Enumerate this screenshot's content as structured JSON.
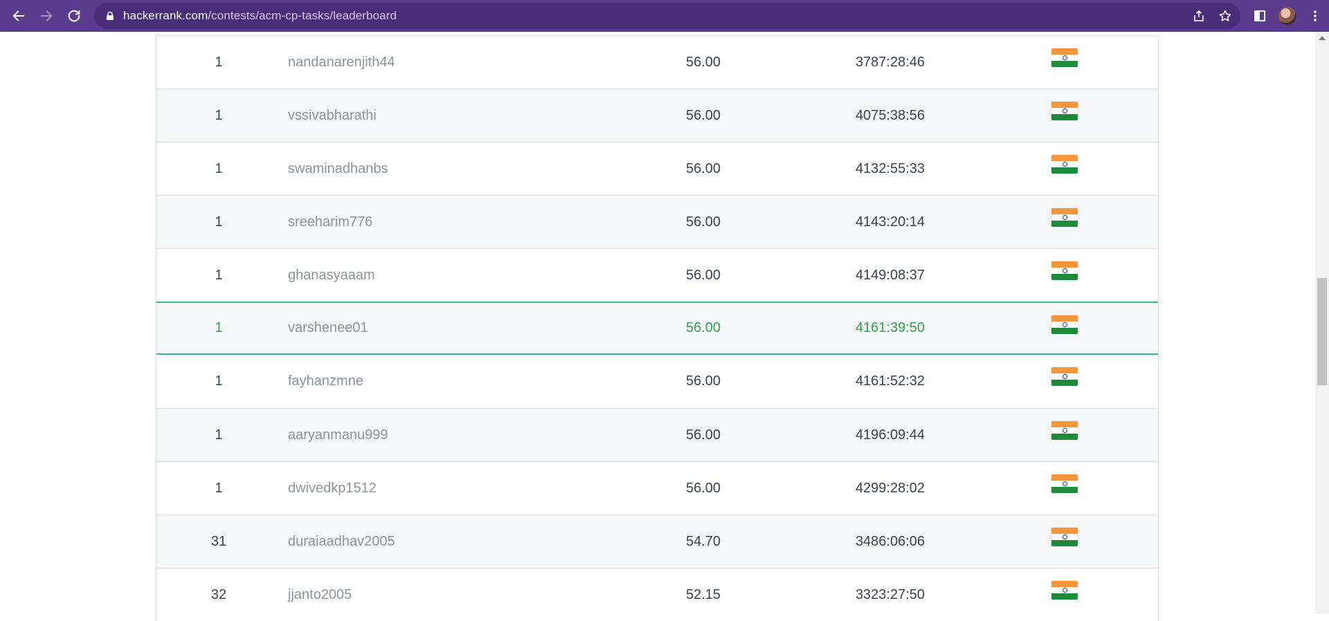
{
  "browser": {
    "url_host": "hackerrank.com",
    "url_path": "/contests/acm-cp-tasks/leaderboard",
    "icons": [
      "back-icon",
      "forward-icon",
      "reload-icon",
      "lock-icon",
      "share-icon",
      "bookmark-star-icon",
      "side-panel-icon",
      "profile-avatar",
      "menu-kebab-icon"
    ]
  },
  "theme": {
    "toolbar": "#5b3b8c",
    "highlight": "#2ea44f",
    "highlight_border": "#39b88a"
  },
  "leaderboard": {
    "rows": [
      {
        "rank": "1",
        "hacker": "nandanarenjith44",
        "score": "56.00",
        "time": "3787:28:46",
        "country": "india-flag"
      },
      {
        "rank": "1",
        "hacker": "vssivabharathi",
        "score": "56.00",
        "time": "4075:38:56",
        "country": "india-flag"
      },
      {
        "rank": "1",
        "hacker": "swaminadhanbs",
        "score": "56.00",
        "time": "4132:55:33",
        "country": "india-flag"
      },
      {
        "rank": "1",
        "hacker": "sreeharim776",
        "score": "56.00",
        "time": "4143:20:14",
        "country": "india-flag"
      },
      {
        "rank": "1",
        "hacker": "ghanasyaaam",
        "score": "56.00",
        "time": "4149:08:37",
        "country": "india-flag"
      },
      {
        "rank": "1",
        "hacker": "varshenee01",
        "score": "56.00",
        "time": "4161:39:50",
        "country": "india-flag",
        "highlighted": true
      },
      {
        "rank": "1",
        "hacker": "fayhanzmne",
        "score": "56.00",
        "time": "4161:52:32",
        "country": "india-flag"
      },
      {
        "rank": "1",
        "hacker": "aaryanmanu999",
        "score": "56.00",
        "time": "4196:09:44",
        "country": "india-flag"
      },
      {
        "rank": "1",
        "hacker": "dwivedkp1512",
        "score": "56.00",
        "time": "4299:28:02",
        "country": "india-flag"
      },
      {
        "rank": "31",
        "hacker": "duraiaadhav2005",
        "score": "54.70",
        "time": "3486:06:06",
        "country": "india-flag"
      },
      {
        "rank": "32",
        "hacker": "jjanto2005",
        "score": "52.15",
        "time": "3323:27:50",
        "country": "india-flag"
      }
    ]
  }
}
